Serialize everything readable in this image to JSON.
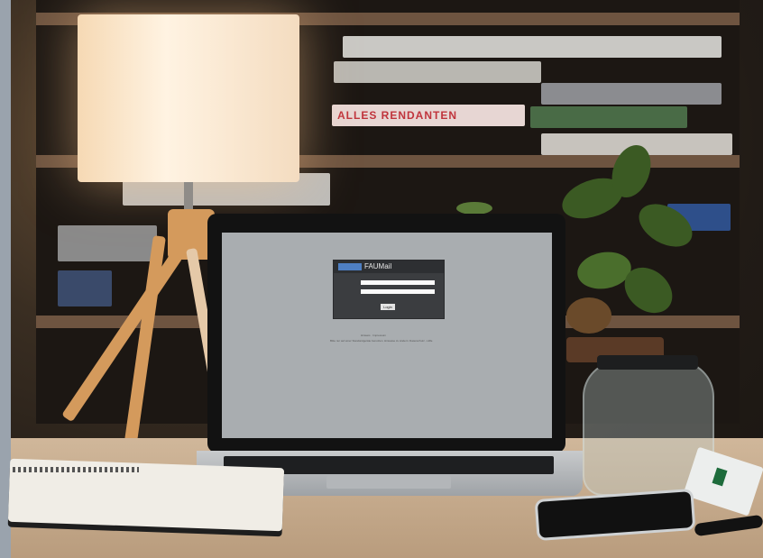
{
  "screen": {
    "brand": "FAUMail",
    "login_button": "Login",
    "footer_line_1": "Hinweis · Impressum",
    "footer_line_2": "Bitte nur auf einer Standardgeräte benutzen. Hinweise zu ändern: Datenschutz - Hilfe"
  },
  "shelf": {
    "book_spine_text": "ALLES RENDANTEN"
  },
  "colors": {
    "lamp_glow": "#fff3e2",
    "screen_bg": "#a9adb0",
    "desk": "#c7ad8f"
  }
}
